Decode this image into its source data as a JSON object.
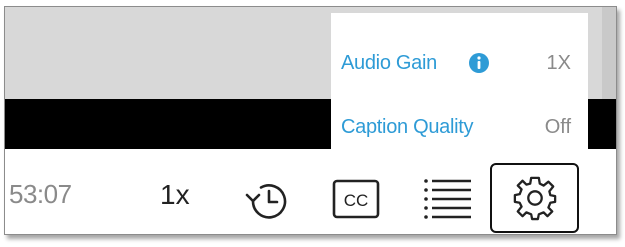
{
  "settings_menu": {
    "items": [
      {
        "label": "Audio Gain",
        "value": "1X",
        "has_info_icon": true,
        "icon": "info-icon"
      },
      {
        "label": "Caption Quality",
        "value": "Off",
        "has_info_icon": false
      }
    ]
  },
  "controls": {
    "time_text": "53:07",
    "speed_label": "1x",
    "icons": [
      "replay-icon",
      "cc-icon",
      "playlist-icon",
      "gear-icon"
    ],
    "cc_text": "CC"
  },
  "colors": {
    "menu_label": "#2e9bd6",
    "menu_value": "#8a8a8a",
    "video_background": "#d8d8d8",
    "settings_button_border": "#111111"
  }
}
